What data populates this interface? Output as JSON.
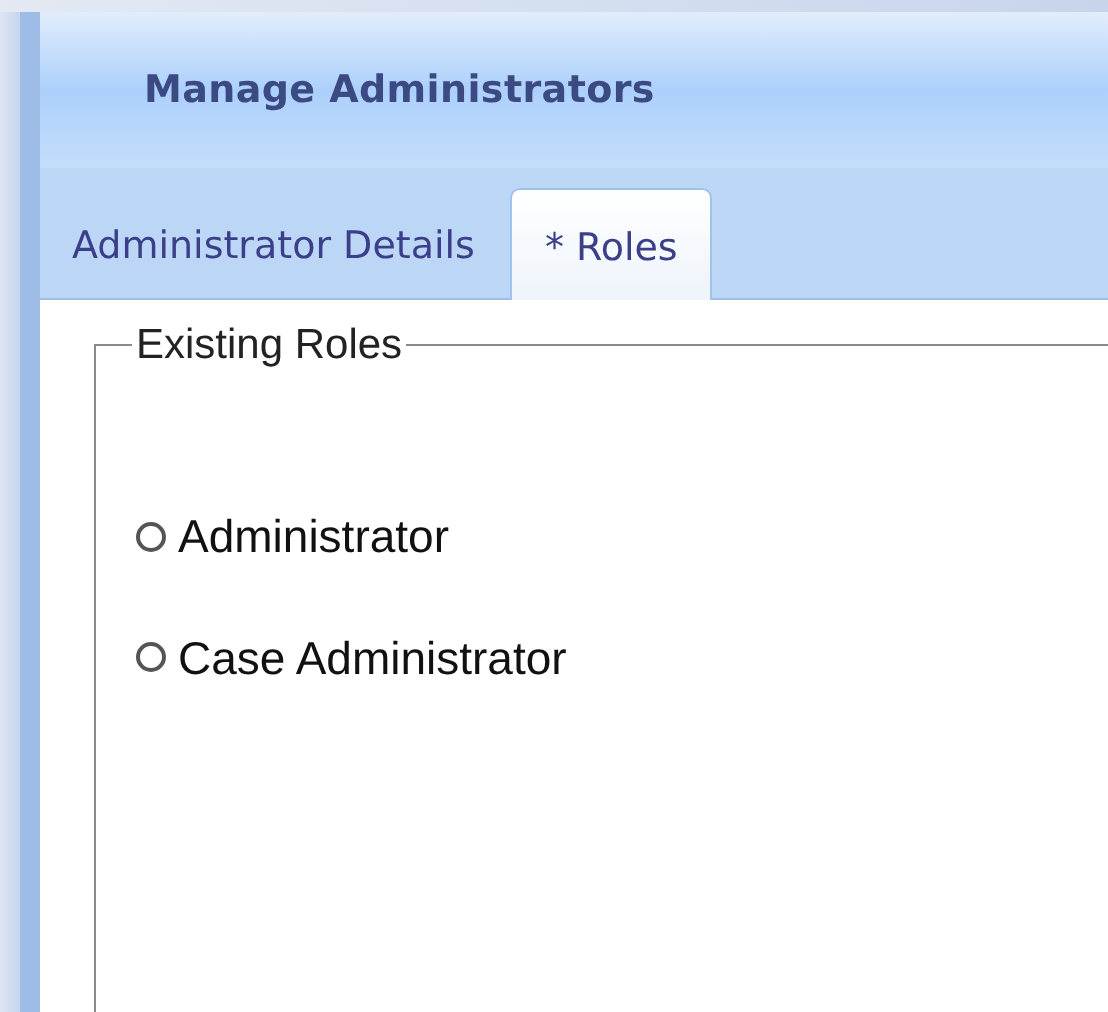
{
  "header": {
    "title": "Manage Administrators"
  },
  "tabs": [
    {
      "label": "Administrator Details",
      "selected": false
    },
    {
      "label": "* Roles",
      "selected": true
    }
  ],
  "fieldset": {
    "legend": "Existing Roles",
    "options": [
      {
        "label": "Administrator",
        "selected": false
      },
      {
        "label": "Case Administrator",
        "selected": false
      }
    ]
  }
}
